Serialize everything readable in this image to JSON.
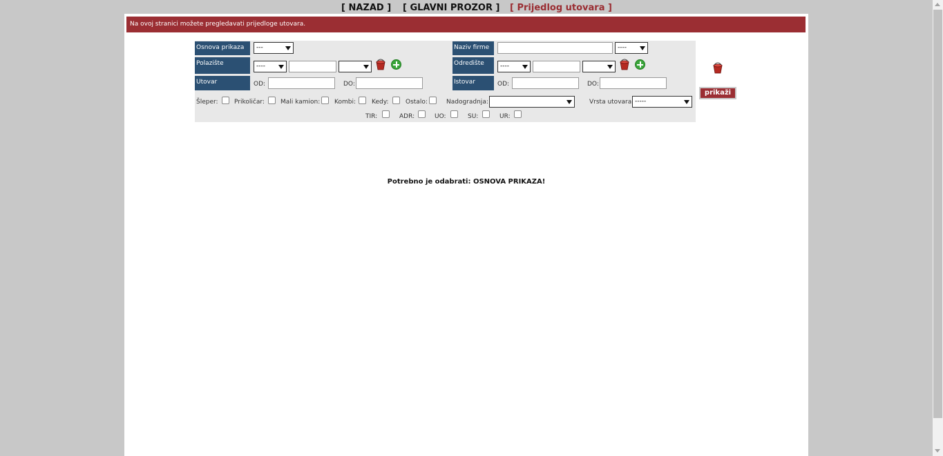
{
  "nav": {
    "back": "[ NAZAD ]",
    "main": "[ GLAVNI PROZOR ]",
    "current": "[ Prijedlog utovara ]"
  },
  "banner": "Na ovoj stranici možete pregledavati prijedloge utovara.",
  "filter": {
    "osnova_label": "Osnova prikaza",
    "osnova_value": "---",
    "naziv_label": "Naziv firme",
    "naziv_value": "",
    "naziv_select": "----",
    "polaziste_label": "Polazište",
    "polaziste_select1": "----",
    "polaziste_text": "",
    "polaziste_select2": "",
    "odrediste_label": "Odredište",
    "odrediste_select1": "----",
    "odrediste_text": "",
    "odrediste_select2": "",
    "utovar_label": "Utovar",
    "istovar_label": "Istovar",
    "od": "OD:",
    "do": "DO:",
    "vehicles": [
      "Šleper:",
      "Prikoličar:",
      "Mali kamion:",
      "Kombi:",
      "Kedy:",
      "Ostalo:"
    ],
    "nadogradnja_label": "Nadogradnja:",
    "nadogradnja_value": "",
    "vrsta_label": "Vrsta utovara:",
    "vrsta_value": "-----",
    "extras": [
      "TIR:",
      "ADR:",
      "UO:",
      "SU:",
      "UR:"
    ]
  },
  "show_button": "prikaži",
  "message": "Potrebno je odabrati: OSNOVA PRIKAZA!",
  "colors": {
    "banner": "#9b2e33",
    "label_bg": "#2b5073",
    "background": "#c8c8c8"
  },
  "icons": [
    "bucket-icon",
    "add-icon"
  ]
}
